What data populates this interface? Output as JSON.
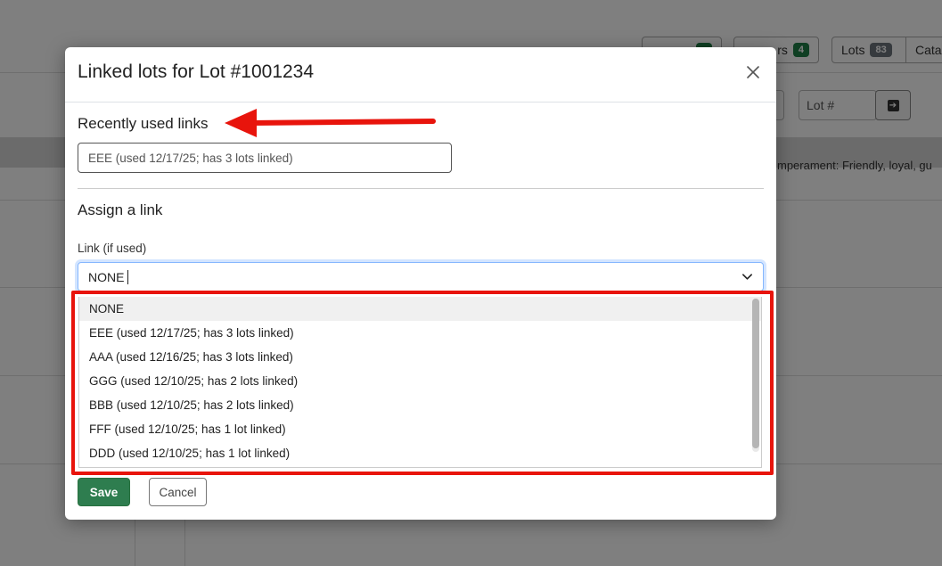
{
  "background": {
    "pills": [
      {
        "label": "",
        "count": ""
      },
      {
        "label": "rs",
        "count": "4"
      },
      {
        "label": "Lots",
        "count": "83"
      },
      {
        "label": "Cata",
        "count": ""
      }
    ],
    "lot_filter_placeholder": "Lot #",
    "row_text": "mperament: Friendly, loyal, gu"
  },
  "modal": {
    "title": "Linked lots for Lot #1001234",
    "recent_section_title": "Recently used links",
    "recent_link": "EEE (used 12/17/25; has 3 lots linked)",
    "assign_section_title": "Assign a link",
    "link_label": "Link (if used)",
    "link_value": "NONE",
    "options": [
      "NONE",
      "EEE (used 12/17/25; has 3 lots linked)",
      "AAA (used 12/16/25; has 3 lots linked)",
      "GGG (used 12/10/25; has 2 lots linked)",
      "BBB (used 12/10/25; has 2 lots linked)",
      "FFF (used 12/10/25; has 1 lot linked)",
      "DDD (used 12/10/25; has 1 lot linked)"
    ],
    "save_label": "Save",
    "cancel_label": "Cancel"
  },
  "colors": {
    "primary_green": "#2e7d4f",
    "annotation_red": "#e8140c",
    "focus_blue": "#86b7fe"
  }
}
